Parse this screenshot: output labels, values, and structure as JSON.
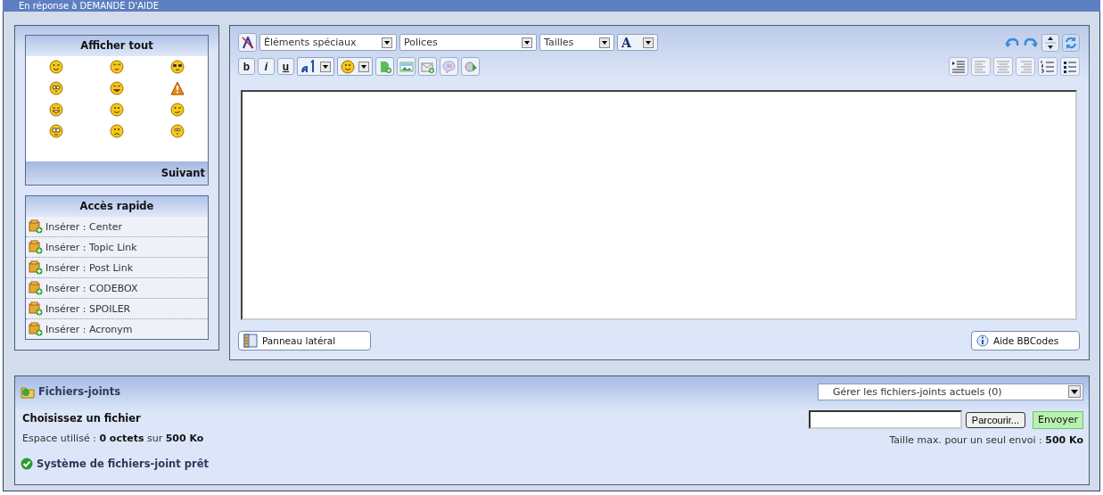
{
  "header": {
    "title": "En réponse à DEMANDE D'AIDE"
  },
  "smilies_box": {
    "title": "Afficher tout",
    "next_link": "Suivant"
  },
  "quick_access": {
    "title": "Accès rapide",
    "items": [
      {
        "label": "Insérer : Center"
      },
      {
        "label": "Insérer : Topic Link"
      },
      {
        "label": "Insérer : Post Link"
      },
      {
        "label": "Insérer : CODEBOX"
      },
      {
        "label": "Insérer : SPOILER"
      },
      {
        "label": "Insérer : Acronym"
      }
    ]
  },
  "editor": {
    "toolbar_selects": [
      {
        "label": "Éléments spéciaux",
        "kind": "wide"
      },
      {
        "label": "Polices",
        "kind": "wide"
      },
      {
        "label": "Tailles",
        "kind": "narrow"
      }
    ],
    "color_button": "A",
    "format_buttons": [
      {
        "label": "b",
        "kind": "bold"
      },
      {
        "label": "i",
        "kind": "italic"
      },
      {
        "label": "u",
        "kind": "underline"
      }
    ],
    "side_panel_button": "Panneau latéral",
    "help_button": "Aide BBCodes"
  },
  "attachments": {
    "title": "Fichiers-joints",
    "manage_select": "Gérer les fichiers-joints actuels (0)",
    "choose_label": "Choisissez un fichier",
    "space_used": "Espace utilisé : **0 octets** sur **500 Ko**",
    "browse_button": "Parcourir...",
    "send_button": "Envoyer",
    "max_size": "Taille max. pour un seul envoi : **500 Ko**",
    "status": "Système de fichiers-joint prêt"
  }
}
